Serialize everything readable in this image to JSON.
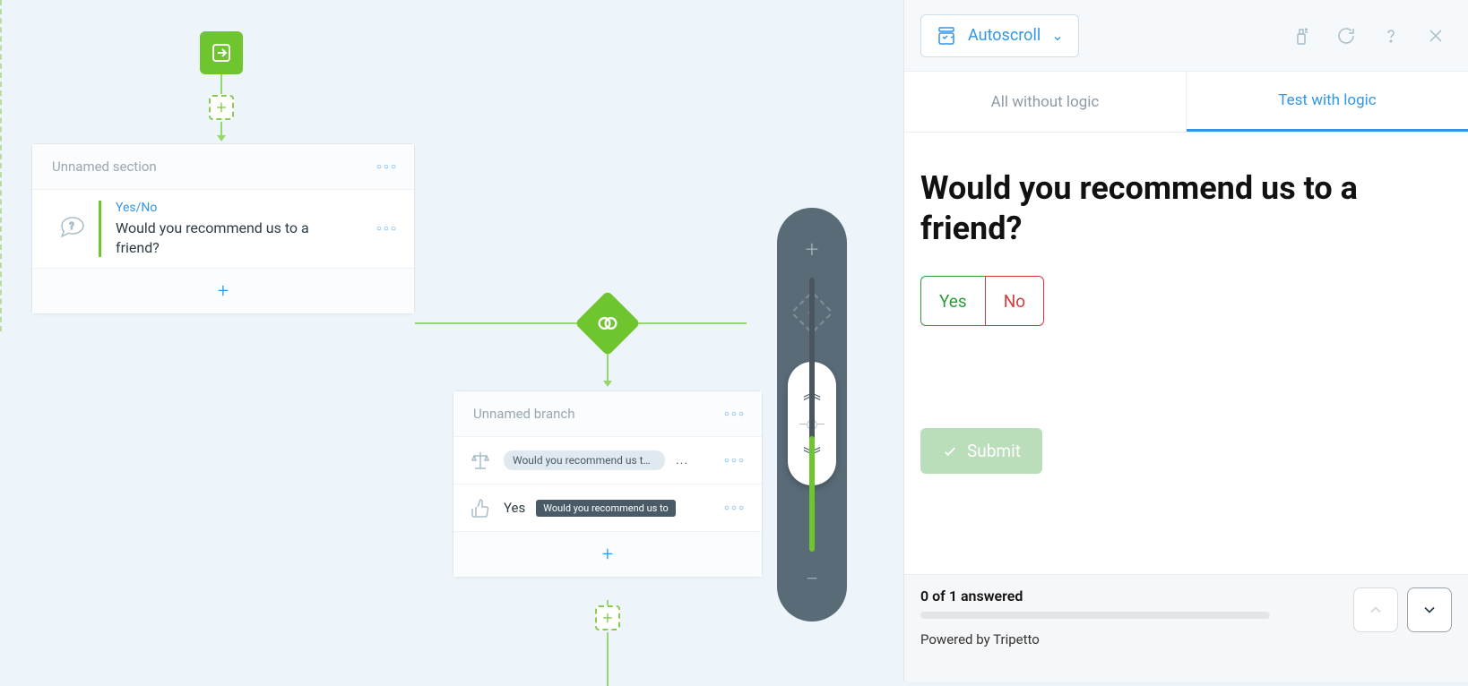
{
  "canvas": {
    "section_title": "Unnamed section",
    "question": {
      "type_label": "Yes/No",
      "text": "Would you recommend us to a friend?"
    },
    "branch": {
      "title": "Unnamed branch",
      "condition_pill": "Would you recommend us to a frie...",
      "result_label": "Yes",
      "result_pill": "Would you recommend us to"
    }
  },
  "preview": {
    "toolbar": {
      "autoscroll_label": "Autoscroll"
    },
    "tabs": {
      "all_label": "All without logic",
      "test_label": "Test with logic"
    },
    "question_title": "Would you recommend us to a friend?",
    "yes_label": "Yes",
    "no_label": "No",
    "submit_label": "Submit",
    "footer": {
      "answered_text": "0 of 1 answered",
      "powered_text": "Powered by Tripetto"
    }
  }
}
